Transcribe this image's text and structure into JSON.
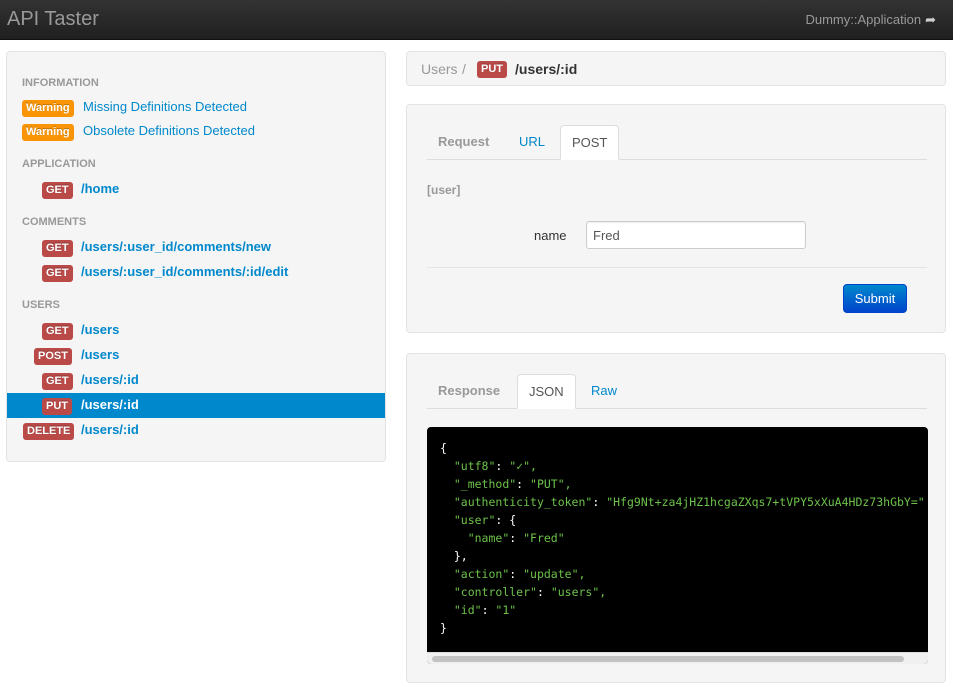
{
  "navbar": {
    "brand": "API Taster",
    "app_link": "Dummy::Application",
    "app_link_icon": "share-arrow-icon"
  },
  "sidebar": {
    "information_header": "INFORMATION",
    "warnings": [
      {
        "badge": "Warning",
        "text": "Missing Definitions Detected"
      },
      {
        "badge": "Warning",
        "text": "Obsolete Definitions Detected"
      }
    ],
    "application_header": "APPLICATION",
    "application_items": [
      {
        "method": "GET",
        "path": "/home"
      }
    ],
    "comments_header": "COMMENTS",
    "comments_items": [
      {
        "method": "GET",
        "path": "/users/:user_id/comments/new"
      },
      {
        "method": "GET",
        "path": "/users/:user_id/comments/:id/edit"
      }
    ],
    "users_header": "USERS",
    "users_items": [
      {
        "method": "GET",
        "path": "/users"
      },
      {
        "method": "POST",
        "path": "/users"
      },
      {
        "method": "GET",
        "path": "/users/:id"
      },
      {
        "method": "PUT",
        "path": "/users/:id",
        "active": true
      },
      {
        "method": "DELETE",
        "path": "/users/:id"
      }
    ]
  },
  "breadcrumb": {
    "root": "Users",
    "separator": "/",
    "method": "PUT",
    "path": "/users/:id"
  },
  "request": {
    "tabs": [
      {
        "label": "Request"
      },
      {
        "label": "URL"
      },
      {
        "label": "POST",
        "active": true
      }
    ],
    "legend": "[user]",
    "field_label": "name",
    "field_value": "Fred",
    "submit_label": "Submit"
  },
  "response": {
    "tabs": [
      {
        "label": "Response"
      },
      {
        "label": "JSON",
        "active": true
      },
      {
        "label": "Raw"
      }
    ],
    "json_lines": [
      {
        "open": "{"
      },
      {
        "key": "\"utf8\"",
        "value": "\"✓\","
      },
      {
        "key": "\"_method\"",
        "value": "\"PUT\","
      },
      {
        "key": "\"authenticity_token\"",
        "value": "\"Hfg9Nt+za4jHZ1hcgaZXqs7+tVPY5xXuA4HDz73hGbY=\""
      },
      {
        "key": "\"user\"",
        "value": "{"
      },
      {
        "key": "\"name\"",
        "value": "\"Fred\""
      },
      {
        "close": "},"
      },
      {
        "key": "\"action\"",
        "value": "\"update\","
      },
      {
        "key": "\"controller\"",
        "value": "\"users\","
      },
      {
        "key": "\"id\"",
        "value": "\"1\""
      },
      {
        "close": "}"
      }
    ]
  },
  "colors": {
    "link": "#0088cc",
    "warning": "#f89406",
    "method": "#b94a48",
    "active": "#0088cc"
  }
}
